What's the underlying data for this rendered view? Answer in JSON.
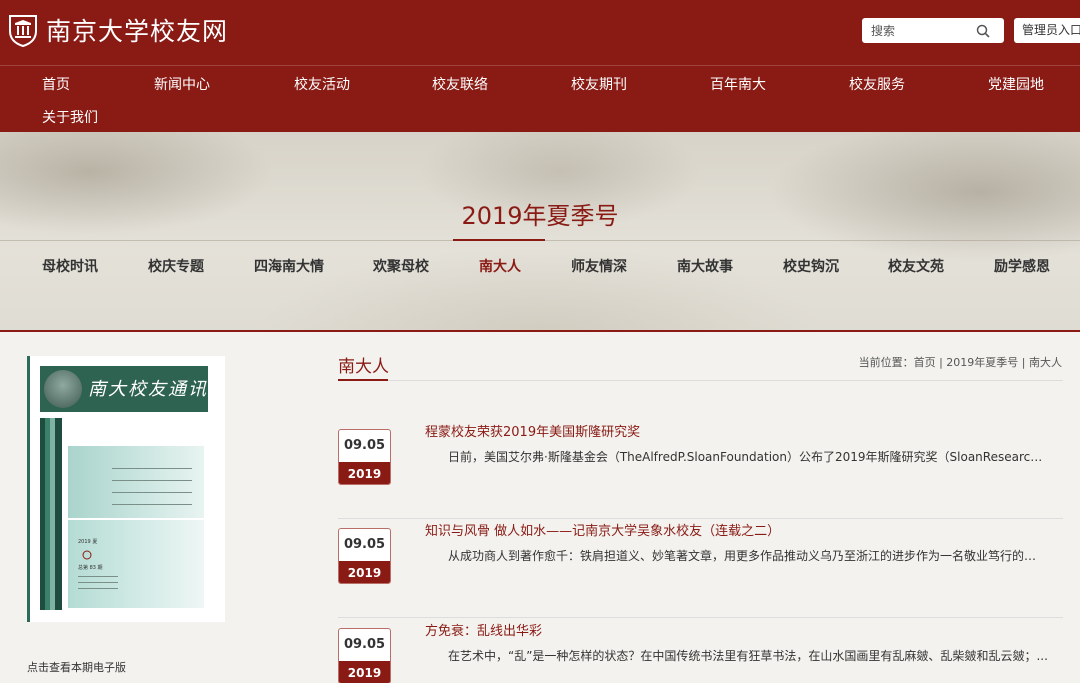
{
  "site": {
    "title": "南京大学校友网",
    "search_placeholder": "搜索",
    "admin_label": "管理员入口"
  },
  "nav": [
    {
      "label": "首页"
    },
    {
      "label": "新闻中心"
    },
    {
      "label": "校友活动"
    },
    {
      "label": "校友联络"
    },
    {
      "label": "校友期刊"
    },
    {
      "label": "百年南大"
    },
    {
      "label": "校友服务"
    },
    {
      "label": "党建园地"
    },
    {
      "label": "关于我们"
    }
  ],
  "banner": {
    "issue_title": "2019年夏季号",
    "categories": [
      {
        "label": "母校时讯"
      },
      {
        "label": "校庆专题"
      },
      {
        "label": "四海南大情"
      },
      {
        "label": "欢聚母校"
      },
      {
        "label": "南大人",
        "active": true
      },
      {
        "label": "师友情深"
      },
      {
        "label": "南大故事"
      },
      {
        "label": "校史钩沉"
      },
      {
        "label": "校友文苑"
      },
      {
        "label": "励学感恩"
      }
    ]
  },
  "sidebar": {
    "cover_calligraphy": "南大校友通讯",
    "cover_year": "2019 夏",
    "cover_issue": "总第 83 期",
    "caption": "点击查看本期电子版"
  },
  "main": {
    "section_title": "南大人",
    "breadcrumb": {
      "prefix": "当前位置：",
      "items": [
        "首页",
        "2019年夏季号",
        "南大人"
      ],
      "separator": " | "
    },
    "news": [
      {
        "day": "09.05",
        "year": "2019",
        "title": "程蒙校友荣获2019年美国斯隆研究奖",
        "summary": "日前，美国艾尔弗·斯隆基金会（TheAlfredP.SloanFoundation）公布了2019年斯隆研究奖（SloanResearchFellow..."
      },
      {
        "day": "09.05",
        "year": "2019",
        "title": "知识与风骨 做人如水——记南京大学吴象水校友（连载之二）",
        "summary": "从成功商人到著作愈千：铁肩担道义、妙笔著文章，用更多作品推动义乌乃至浙江的进步作为一名敬业笃行的新闻..."
      },
      {
        "day": "09.05",
        "year": "2019",
        "title": "方免衰：乱线出华彩",
        "summary": "在艺术中，“乱”是一种怎样的状态？在中国传统书法里有狂草书法，在山水国画里有乱麻皴、乱柴皴和乱云皴；..."
      }
    ]
  },
  "colors": {
    "brand": "#8a1a14",
    "banner_bg": "#dcd8cf",
    "cover_green": "#2f6351"
  }
}
